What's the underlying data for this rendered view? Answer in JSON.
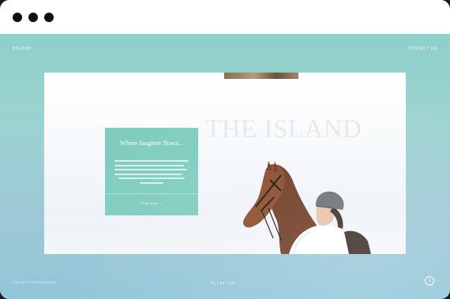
{
  "site": {
    "brand": "BYLAND",
    "nav_label": "CONTACT US",
    "hero_title": "THE ISLAND",
    "counter": "01 / 02 / 03",
    "footer_note": "Copyright 2023 Byland Studio"
  },
  "card": {
    "title": "Where laughter flows...",
    "cta": "Read more →"
  },
  "icons": {
    "window_controls": [
      "dot",
      "dot",
      "dot"
    ],
    "round_button": "scroll-icon"
  },
  "colors": {
    "accent": "#80cdbf",
    "background_top": "#8fd0c9",
    "background_bottom": "#92c6d8"
  }
}
